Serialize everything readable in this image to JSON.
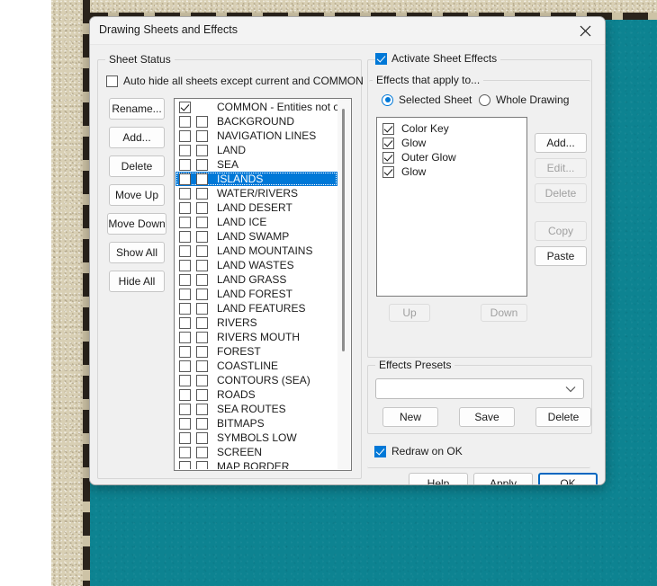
{
  "window": {
    "title": "Drawing Sheets and Effects",
    "close_icon": "close-icon"
  },
  "sheet_status": {
    "group_title": "Sheet Status",
    "auto_hide": {
      "label": "Auto hide all sheets except current and COMMON",
      "checked": false
    },
    "buttons": [
      {
        "label": "Rename...",
        "disabled": false
      },
      {
        "label": "Add...",
        "disabled": false
      },
      {
        "label": "Delete",
        "disabled": false
      },
      {
        "label": "Move Up",
        "disabled": false
      },
      {
        "label": "Move Down",
        "disabled": false
      },
      {
        "label": "Show All",
        "disabled": false
      },
      {
        "label": "Hide All",
        "disabled": false
      }
    ],
    "sheets": [
      {
        "label": "COMMON - Entities not on",
        "single_checkbox": true,
        "checked": true,
        "checked2": false,
        "selected": false
      },
      {
        "label": "BACKGROUND",
        "single_checkbox": false,
        "checked": false,
        "checked2": false,
        "selected": false
      },
      {
        "label": "NAVIGATION LINES",
        "single_checkbox": false,
        "checked": false,
        "checked2": false,
        "selected": false
      },
      {
        "label": "LAND",
        "single_checkbox": false,
        "checked": false,
        "checked2": false,
        "selected": false
      },
      {
        "label": "SEA",
        "single_checkbox": false,
        "checked": false,
        "checked2": false,
        "selected": false
      },
      {
        "label": "ISLANDS",
        "single_checkbox": false,
        "checked": false,
        "checked2": false,
        "selected": true
      },
      {
        "label": "WATER/RIVERS",
        "single_checkbox": false,
        "checked": false,
        "checked2": false,
        "selected": false
      },
      {
        "label": "LAND DESERT",
        "single_checkbox": false,
        "checked": false,
        "checked2": false,
        "selected": false
      },
      {
        "label": "LAND ICE",
        "single_checkbox": false,
        "checked": false,
        "checked2": false,
        "selected": false
      },
      {
        "label": "LAND SWAMP",
        "single_checkbox": false,
        "checked": false,
        "checked2": false,
        "selected": false
      },
      {
        "label": "LAND MOUNTAINS",
        "single_checkbox": false,
        "checked": false,
        "checked2": false,
        "selected": false
      },
      {
        "label": "LAND WASTES",
        "single_checkbox": false,
        "checked": false,
        "checked2": false,
        "selected": false
      },
      {
        "label": "LAND GRASS",
        "single_checkbox": false,
        "checked": false,
        "checked2": false,
        "selected": false
      },
      {
        "label": "LAND FOREST",
        "single_checkbox": false,
        "checked": false,
        "checked2": false,
        "selected": false
      },
      {
        "label": "LAND FEATURES",
        "single_checkbox": false,
        "checked": false,
        "checked2": false,
        "selected": false
      },
      {
        "label": "RIVERS",
        "single_checkbox": false,
        "checked": false,
        "checked2": false,
        "selected": false
      },
      {
        "label": "RIVERS MOUTH",
        "single_checkbox": false,
        "checked": false,
        "checked2": false,
        "selected": false
      },
      {
        "label": "FOREST",
        "single_checkbox": false,
        "checked": false,
        "checked2": false,
        "selected": false
      },
      {
        "label": "COASTLINE",
        "single_checkbox": false,
        "checked": false,
        "checked2": false,
        "selected": false
      },
      {
        "label": "CONTOURS (SEA)",
        "single_checkbox": false,
        "checked": false,
        "checked2": false,
        "selected": false
      },
      {
        "label": "ROADS",
        "single_checkbox": false,
        "checked": false,
        "checked2": false,
        "selected": false
      },
      {
        "label": "SEA ROUTES",
        "single_checkbox": false,
        "checked": false,
        "checked2": false,
        "selected": false
      },
      {
        "label": "BITMAPS",
        "single_checkbox": false,
        "checked": false,
        "checked2": false,
        "selected": false
      },
      {
        "label": "SYMBOLS LOW",
        "single_checkbox": false,
        "checked": false,
        "checked2": false,
        "selected": false
      },
      {
        "label": "SCREEN",
        "single_checkbox": false,
        "checked": false,
        "checked2": false,
        "selected": false
      },
      {
        "label": "MAP BORDER",
        "single_checkbox": false,
        "checked": false,
        "checked2": false,
        "selected": false
      }
    ]
  },
  "effects": {
    "activate": {
      "label": "Activate Sheet Effects",
      "checked": true
    },
    "apply_to": {
      "group_title": "Effects that apply to...",
      "options": [
        {
          "label": "Selected Sheet",
          "selected": true
        },
        {
          "label": "Whole Drawing",
          "selected": false
        }
      ]
    },
    "list": [
      {
        "label": "Color Key",
        "checked": true
      },
      {
        "label": "Glow",
        "checked": true
      },
      {
        "label": "Outer Glow",
        "checked": true
      },
      {
        "label": "Glow",
        "checked": true
      }
    ],
    "side_buttons": [
      {
        "label": "Add...",
        "disabled": false
      },
      {
        "label": "Edit...",
        "disabled": true
      },
      {
        "label": "Delete",
        "disabled": true
      },
      {
        "label": "Copy",
        "disabled": true
      },
      {
        "label": "Paste",
        "disabled": false
      }
    ],
    "order_buttons": [
      {
        "label": "Up",
        "disabled": true
      },
      {
        "label": "Down",
        "disabled": true
      }
    ]
  },
  "presets": {
    "group_title": "Effects Presets",
    "combo_value": "",
    "combo_icon": "chevron-down-icon",
    "buttons": [
      {
        "label": "New",
        "disabled": false
      },
      {
        "label": "Save",
        "disabled": false
      },
      {
        "label": "Delete",
        "disabled": false
      }
    ]
  },
  "redraw": {
    "label": "Redraw on OK",
    "checked": true
  },
  "footer": {
    "buttons": [
      {
        "label": "Help",
        "default": false
      },
      {
        "label": "Apply",
        "default": false
      },
      {
        "label": "OK",
        "default": true
      }
    ]
  },
  "colors": {
    "accent": "#0078d7",
    "default_button_border": "#0067c0",
    "dialog_bg": "#f0f0f0",
    "canvas_teal": "#0d8391",
    "parchment": "#d8cfb4"
  }
}
